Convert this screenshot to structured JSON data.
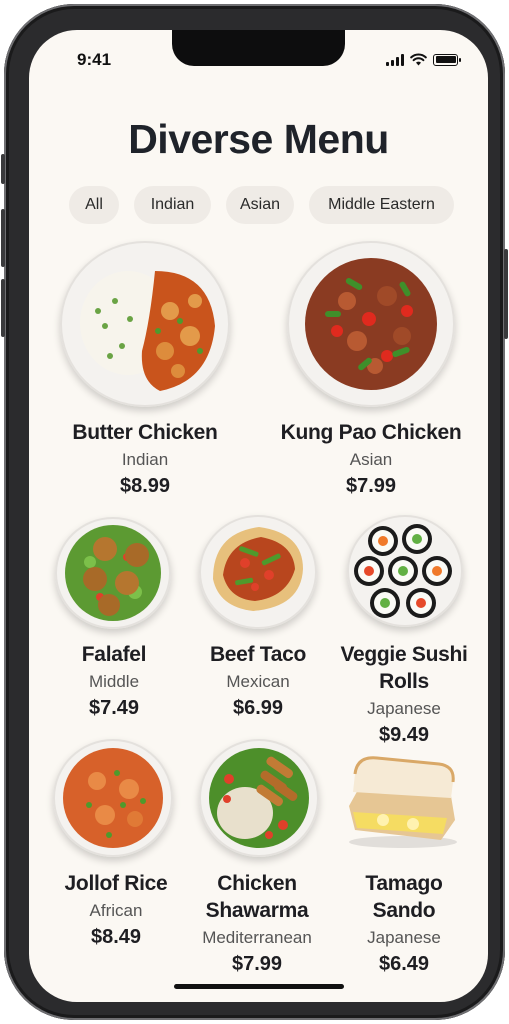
{
  "status_bar": {
    "time": "9:41"
  },
  "page": {
    "title": "Diverse Menu"
  },
  "filters": [
    {
      "label": "All"
    },
    {
      "label": "Indian"
    },
    {
      "label": "Asian"
    },
    {
      "label": "Middle Eastern"
    }
  ],
  "items": [
    {
      "name": "Butter Chicken",
      "cuisine": "Indian",
      "price": "$8.99"
    },
    {
      "name": "Kung Pao Chicken",
      "cuisine": "Asian",
      "price": "$7.99"
    },
    {
      "name": "Falafel",
      "cuisine": "Middle",
      "price": "$7.49"
    },
    {
      "name": "Beef Taco",
      "cuisine": "Mexican",
      "price": "$6.99"
    },
    {
      "name_line1": "Veggie Sushi",
      "name_line2": "Rolls",
      "cuisine": "Japanese",
      "price": "$9.49"
    },
    {
      "name": "Jollof Rice",
      "cuisine": "African",
      "price": "$8.49"
    },
    {
      "name_line1": "Chicken",
      "name_line2": "Shawarma",
      "cuisine": "Mediterranean",
      "price": "$7.99"
    },
    {
      "name_line1": "Tamago",
      "name_line2": "Sando",
      "cuisine": "Japanese",
      "price": "$6.49"
    }
  ],
  "colors": {
    "background": "#fbf8f3",
    "chip": "#efebe6",
    "text": "#1e1e22"
  }
}
